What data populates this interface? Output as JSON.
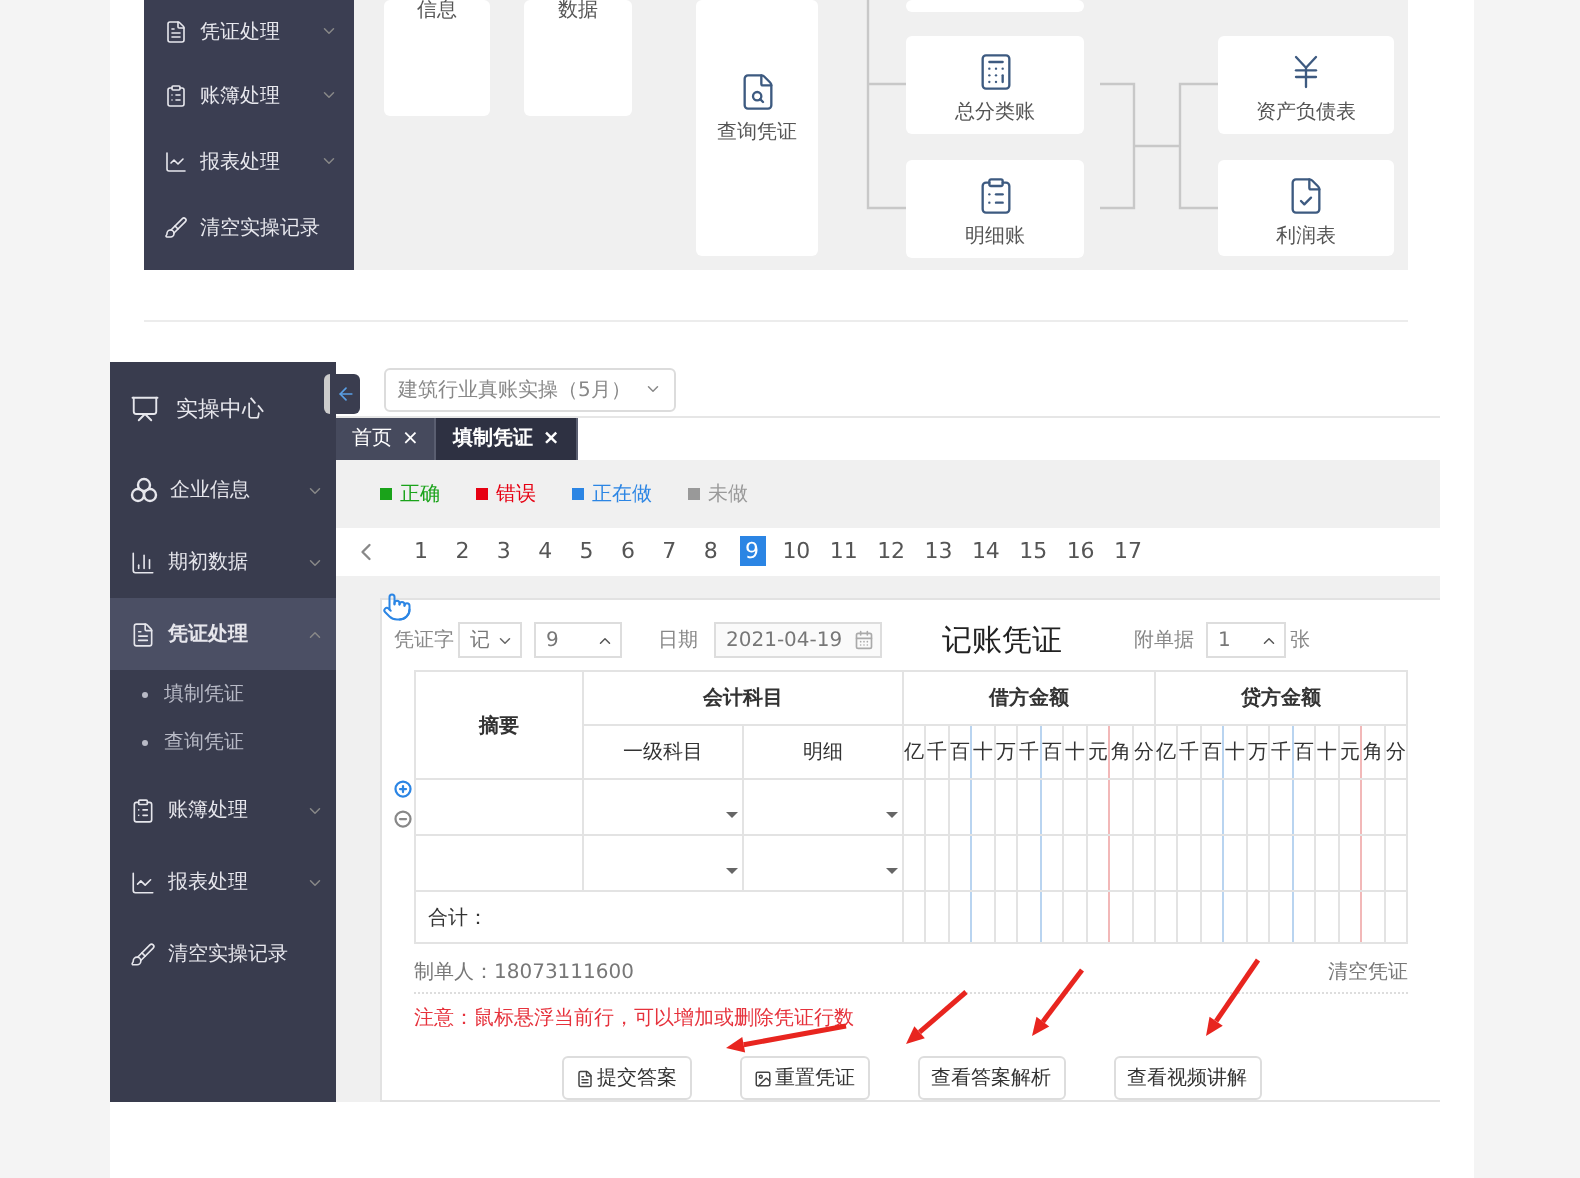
{
  "catalog_top": {
    "sidebar": [
      {
        "label": "凭证处理",
        "expanded": false
      },
      {
        "label": "账簿处理",
        "expanded": false
      },
      {
        "label": "报表处理",
        "expanded": false
      },
      {
        "label": "清空实操记录"
      }
    ],
    "cards": [
      {
        "label": "信息"
      },
      {
        "label": "数据"
      },
      {
        "label": "查询凭证"
      },
      {
        "label": "总分类账"
      },
      {
        "label": "明细账"
      },
      {
        "label": "资产负债表"
      },
      {
        "label": "利润表"
      }
    ]
  },
  "app": {
    "sidebar": {
      "title": "实操中心",
      "items": [
        {
          "label": "企业信息",
          "expanded": false,
          "selected": false
        },
        {
          "label": "期初数据",
          "expanded": false,
          "selected": false
        },
        {
          "label": "凭证处理",
          "expanded": true,
          "selected": true,
          "children": [
            {
              "label": "填制凭证"
            },
            {
              "label": "查询凭证"
            }
          ]
        },
        {
          "label": "账簿处理",
          "expanded": false,
          "selected": false
        },
        {
          "label": "报表处理",
          "expanded": false,
          "selected": false
        },
        {
          "label": "清空实操记录",
          "selected": false
        }
      ]
    },
    "course_select": {
      "value": "建筑行业真账实操（5月）"
    },
    "tabs": [
      {
        "label": "首页",
        "close": "×",
        "selected": false
      },
      {
        "label": "填制凭证",
        "close": "×",
        "selected": true
      }
    ],
    "legend": [
      {
        "label": "正确",
        "color": "#1aa31a"
      },
      {
        "label": "错误",
        "color": "#e60012"
      },
      {
        "label": "正在做",
        "color": "#2b85e4"
      },
      {
        "label": "未做",
        "color": "#999999"
      }
    ],
    "pages": [
      {
        "label": "1",
        "selected": false
      },
      {
        "label": "2",
        "selected": false
      },
      {
        "label": "3",
        "selected": false
      },
      {
        "label": "4",
        "selected": false
      },
      {
        "label": "5",
        "selected": false
      },
      {
        "label": "6",
        "selected": false
      },
      {
        "label": "7",
        "selected": false
      },
      {
        "label": "8",
        "selected": false
      },
      {
        "label": "9",
        "selected": true
      },
      {
        "label": "10",
        "selected": false
      },
      {
        "label": "11",
        "selected": false
      },
      {
        "label": "12",
        "selected": false
      },
      {
        "label": "13",
        "selected": false
      },
      {
        "label": "14",
        "selected": false
      },
      {
        "label": "15",
        "selected": false
      },
      {
        "label": "16",
        "selected": false
      },
      {
        "label": "17",
        "selected": false
      }
    ],
    "voucher": {
      "type_label": "凭证字",
      "type_value": "记",
      "number": "9",
      "date_label": "日期",
      "date": "2021-04-19",
      "title": "记账凭证",
      "attach_label": "附单据",
      "attach_count": "1",
      "attach_unit": "张",
      "headers": {
        "summary": "摘要",
        "account": "会计科目",
        "account_sub": [
          "一级科目",
          "明细"
        ],
        "debit": "借方金额",
        "credit": "贷方金额",
        "debit_digits": [
          "亿",
          "千",
          "百",
          "十",
          "万",
          "千",
          "百",
          "十",
          "元",
          "角",
          "分"
        ],
        "credit_digits": [
          "亿",
          "千",
          "百",
          "十",
          "万",
          "千",
          "百",
          "十",
          "元",
          "角",
          "分"
        ]
      },
      "total": "合计：",
      "maker": "制单人：18073111600",
      "clear": "清空凭证",
      "note": "注意：鼠标悬浮当前行，可以增加或删除凭证行数",
      "buttons": [
        {
          "label": "提交答案"
        },
        {
          "label": "重置凭证"
        },
        {
          "label": "查看答案解析"
        },
        {
          "label": "查看视频讲解"
        }
      ]
    }
  }
}
